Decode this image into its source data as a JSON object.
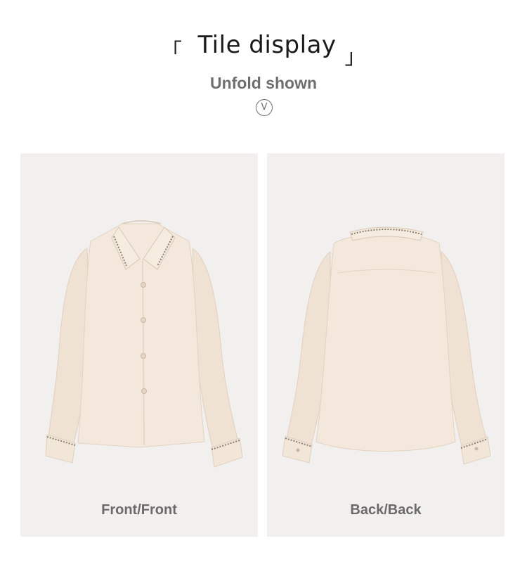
{
  "header": {
    "bracket_open": "「",
    "title": "Tile display",
    "bracket_close": "」",
    "subtitle": "Unfold shown",
    "chevron_letter": "V",
    "chevron_icon": "chevron-down-circle-icon"
  },
  "panels": [
    {
      "caption": "Front/Front",
      "image": "blouse-front-image"
    },
    {
      "caption": "Back/Back",
      "image": "blouse-back-image"
    }
  ],
  "colors": {
    "panel_bg": "#f1f0ee",
    "blouse": "#f0e4d6",
    "blouse_shadow": "#e2d3c2",
    "trim": "#8a7f70",
    "caption": "#6a6a6a"
  }
}
